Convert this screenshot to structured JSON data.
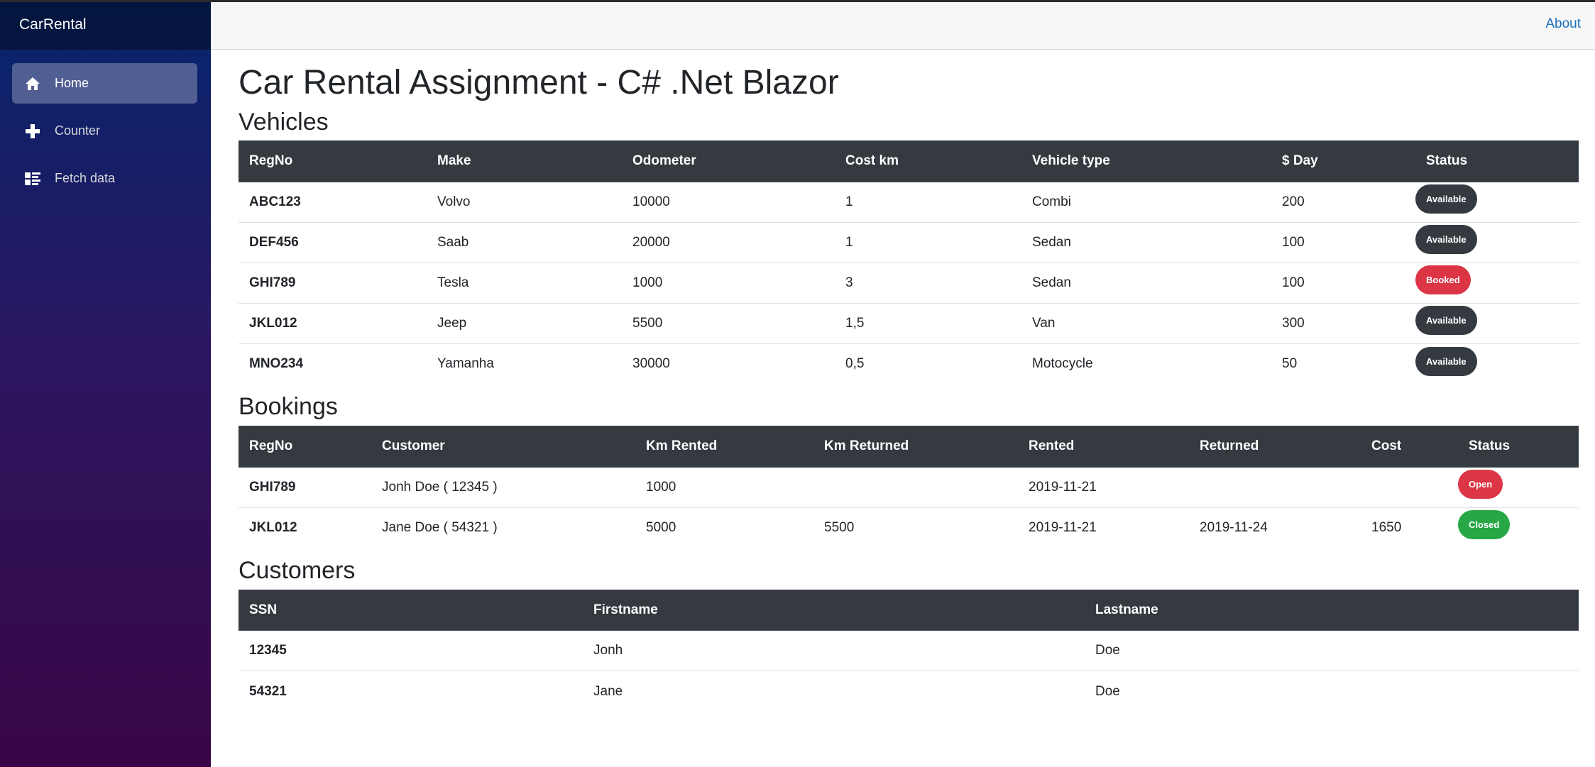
{
  "app": {
    "brand": "CarRental"
  },
  "nav": [
    {
      "label": "Home",
      "icon": "home-icon",
      "active": true
    },
    {
      "label": "Counter",
      "icon": "plus-icon",
      "active": false
    },
    {
      "label": "Fetch data",
      "icon": "list-icon",
      "active": false
    }
  ],
  "topbar": {
    "about": "About"
  },
  "page": {
    "title": "Car Rental Assignment - C# .Net Blazor",
    "vehicles_heading": "Vehicles",
    "bookings_heading": "Bookings",
    "customers_heading": "Customers"
  },
  "vehicles": {
    "headers": [
      "RegNo",
      "Make",
      "Odometer",
      "Cost km",
      "Vehicle type",
      "$ Day",
      "Status"
    ],
    "rows": [
      {
        "regno": "ABC123",
        "make": "Volvo",
        "odometer": "10000",
        "cost_km": "1",
        "type": "Combi",
        "day": "200",
        "status": "Available"
      },
      {
        "regno": "DEF456",
        "make": "Saab",
        "odometer": "20000",
        "cost_km": "1",
        "type": "Sedan",
        "day": "100",
        "status": "Available"
      },
      {
        "regno": "GHI789",
        "make": "Tesla",
        "odometer": "1000",
        "cost_km": "3",
        "type": "Sedan",
        "day": "100",
        "status": "Booked"
      },
      {
        "regno": "JKL012",
        "make": "Jeep",
        "odometer": "5500",
        "cost_km": "1,5",
        "type": "Van",
        "day": "300",
        "status": "Available"
      },
      {
        "regno": "MNO234",
        "make": "Yamanha",
        "odometer": "30000",
        "cost_km": "0,5",
        "type": "Motocycle",
        "day": "50",
        "status": "Available"
      }
    ]
  },
  "bookings": {
    "headers": [
      "RegNo",
      "Customer",
      "Km Rented",
      "Km Returned",
      "Rented",
      "Returned",
      "Cost",
      "Status"
    ],
    "rows": [
      {
        "regno": "GHI789",
        "customer": "Jonh Doe ( 12345 )",
        "km_rented": "1000",
        "km_returned": "",
        "rented": "2019-11-21",
        "returned": "",
        "cost": "",
        "status": "Open"
      },
      {
        "regno": "JKL012",
        "customer": "Jane Doe ( 54321 )",
        "km_rented": "5000",
        "km_returned": "5500",
        "rented": "2019-11-21",
        "returned": "2019-11-24",
        "cost": "1650",
        "status": "Closed"
      }
    ]
  },
  "customers": {
    "headers": [
      "SSN",
      "Firstname",
      "Lastname"
    ],
    "rows": [
      {
        "ssn": "12345",
        "firstname": "Jonh",
        "lastname": "Doe"
      },
      {
        "ssn": "54321",
        "firstname": "Jane",
        "lastname": "Doe"
      }
    ]
  },
  "colors": {
    "available": "#343a40",
    "booked": "#dc3545",
    "open": "#dc3545",
    "closed": "#28a745",
    "link": "#1b6ec2"
  }
}
